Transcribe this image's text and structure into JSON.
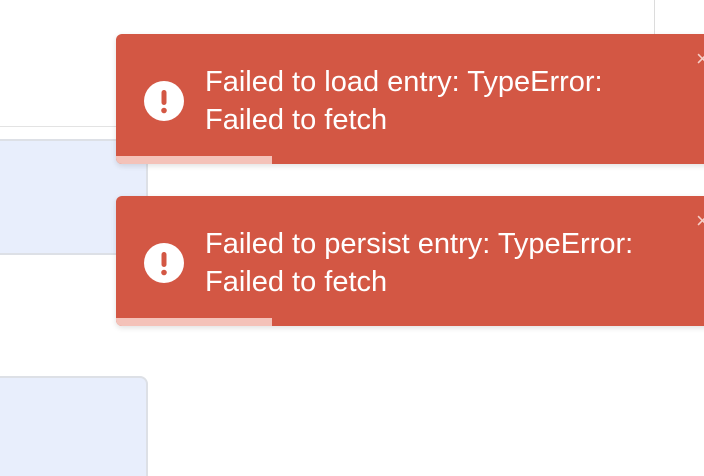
{
  "colors": {
    "toast_bg": "#d35744",
    "toast_text": "#ffffff",
    "progress_bar": "#f4c2b9",
    "background_card": "#e8eefc"
  },
  "toasts": [
    {
      "type": "error",
      "icon": "exclamation-icon",
      "message": "Failed to load entry: TypeError: Failed to fetch",
      "close_glyph": "×",
      "progress_remaining": 0.26
    },
    {
      "type": "error",
      "icon": "exclamation-icon",
      "message": "Failed to persist entry: TypeError: Failed to fetch",
      "close_glyph": "×",
      "progress_remaining": 0.26
    }
  ]
}
